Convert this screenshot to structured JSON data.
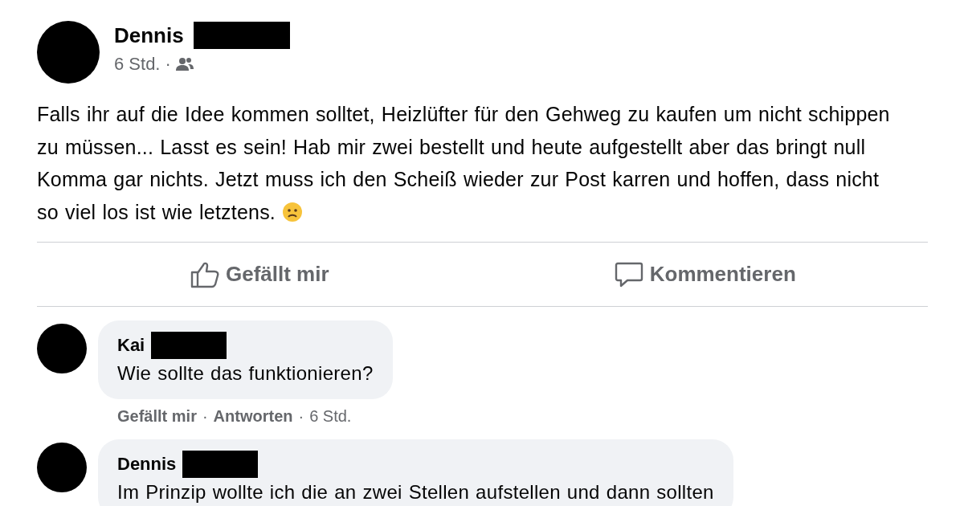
{
  "post": {
    "author": {
      "name": "Dennis",
      "redacted": true
    },
    "time": "6 Std.",
    "separator": "·",
    "text": "Falls ihr auf die Idee kommen solltet, Heizlüfter für den Gehweg zu kaufen um nicht schippen zu müssen... Lasst es sein! Hab mir zwei bestellt und heute aufgestellt aber das bringt null Komma gar nichts. Jetzt muss ich den Scheiß wieder zur Post karren und hoffen, dass nicht so viel los ist wie letztens."
  },
  "actions": [
    {
      "kind": "like",
      "label": "Gefällt mir"
    },
    {
      "kind": "comment",
      "label": "Kommentieren"
    }
  ],
  "comments": [
    {
      "author": "Kai",
      "redacted": true,
      "text": "Wie sollte das funktionieren?",
      "meta": [
        {
          "label": "Gefällt mir"
        },
        {
          "label": "·",
          "kind": "separator"
        },
        {
          "label": "Antworten"
        },
        {
          "label": "·",
          "kind": "separator"
        },
        {
          "label": "6 Std.",
          "kind": "time"
        }
      ]
    },
    {
      "author": "Dennis",
      "redacted": true,
      "text": "Im Prinzip wollte ich die an zwei Stellen aufstellen und dann sollten"
    }
  ]
}
